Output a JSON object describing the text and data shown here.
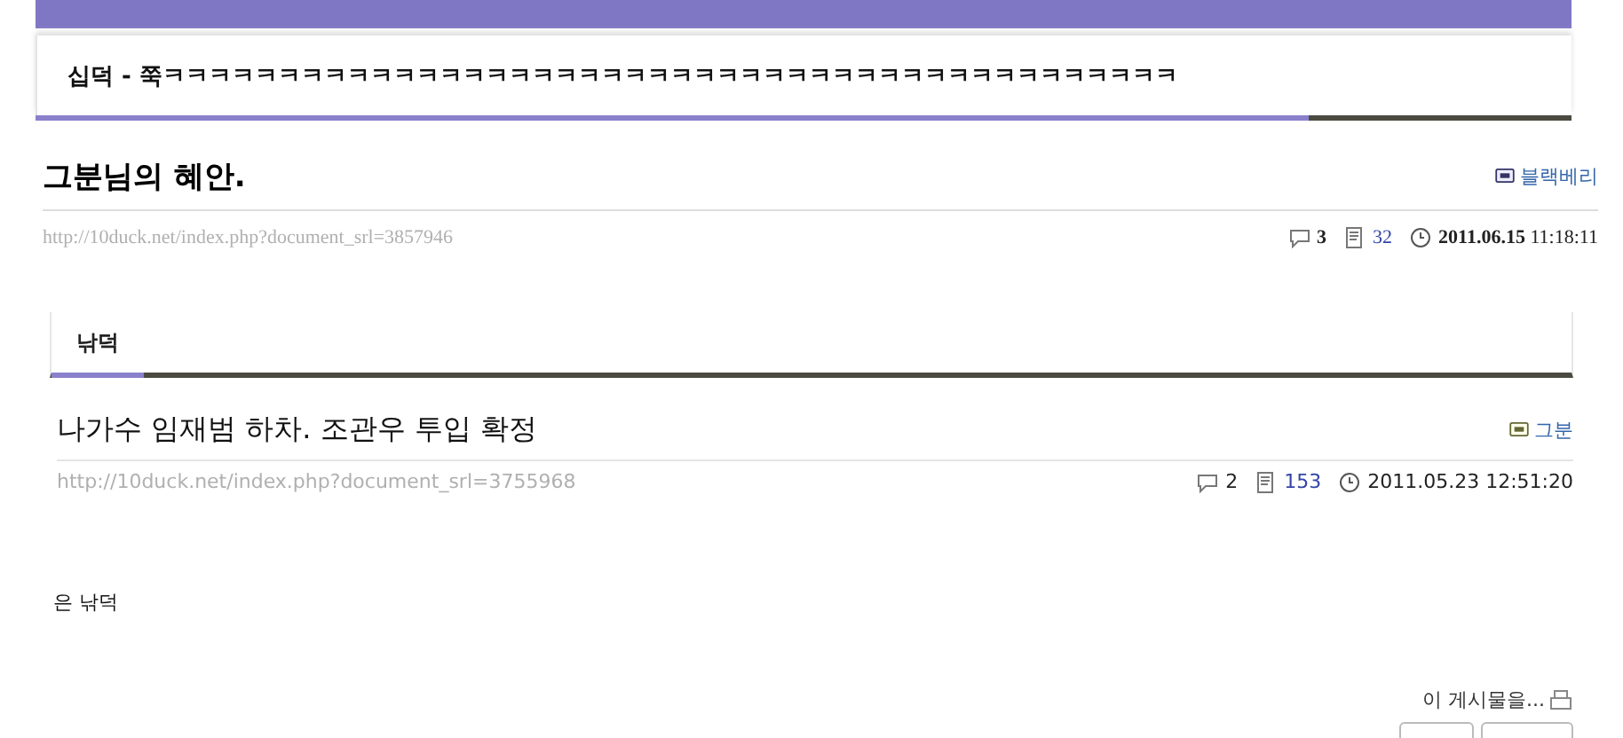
{
  "top_post": {
    "category": "십덕 - 쭉ㅋㅋㅋㅋㅋㅋㅋㅋㅋㅋㅋㅋㅋㅋㅋㅋㅋㅋㅋㅋㅋㅋㅋㅋㅋㅋㅋㅋㅋㅋㅋㅋㅋㅋㅋㅋㅋㅋㅋㅋㅋㅋㅋㅋ",
    "title": "그분님의 혜안.",
    "author": "블랙베리",
    "url": "http://10duck.net/index.php?document_srl=3857946",
    "comments": "3",
    "views": "32",
    "date": "2011.06.15",
    "time": "11:18:11"
  },
  "tabs": [
    {
      "label": "낚덕",
      "selected": true
    }
  ],
  "post": {
    "title": "나가수 임재범 하차. 조관우 투입 확정",
    "author": "그분",
    "url": "http://10duck.net/index.php?document_srl=3755968",
    "comments": "2",
    "views": "153",
    "datetime": "2011.05.23 12:51:20",
    "body": "은 낚덕"
  },
  "actions": {
    "label": "이 게시물을..."
  }
}
